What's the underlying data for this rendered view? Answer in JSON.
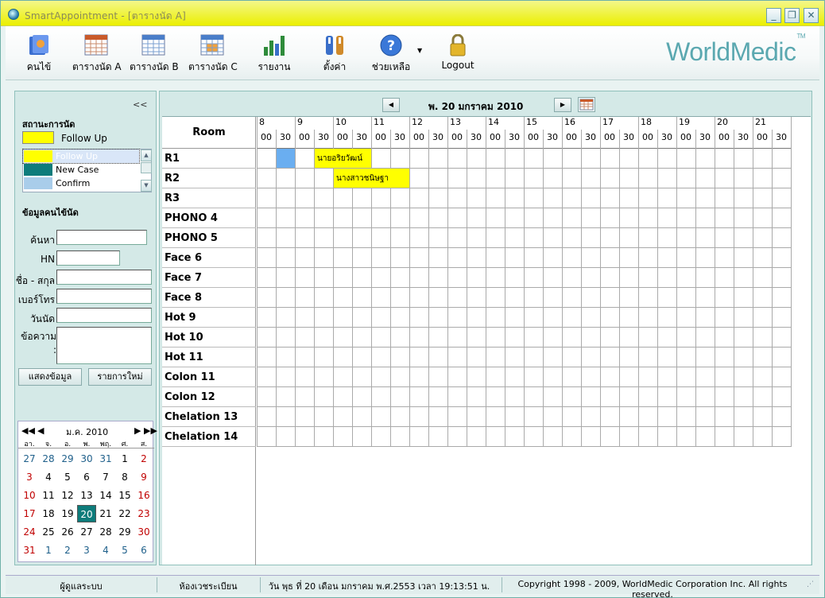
{
  "window": {
    "title": "SmartAppointment - [ตารางนัด A]"
  },
  "toolbar": {
    "items": [
      {
        "label": "คนไข้",
        "icon": "patient-book-icon"
      },
      {
        "label": "ตารางนัด A",
        "icon": "calendar-a-icon"
      },
      {
        "label": "ตารางนัด B",
        "icon": "calendar-b-icon"
      },
      {
        "label": "ตารางนัด C",
        "icon": "calendar-c-icon"
      },
      {
        "label": "รายงาน",
        "icon": "bar-chart-icon"
      },
      {
        "label": "ตั้งค่า",
        "icon": "tools-icon"
      },
      {
        "label": "ช่วยเหลือ",
        "icon": "help-icon"
      },
      {
        "label": "Logout",
        "icon": "padlock-icon"
      }
    ],
    "brand": "WorldMedic",
    "brand_tm": "TM"
  },
  "left": {
    "collapse": "<<",
    "status_title": "สถานะการนัด",
    "legend_selected": {
      "label": "Follow Up",
      "color": "#ffff00"
    },
    "status_list": [
      {
        "label": "Follow Up",
        "color": "#ffff00"
      },
      {
        "label": "New Case",
        "color": "#0e7c7b"
      },
      {
        "label": "Confirm",
        "color": "#a9cdea"
      }
    ],
    "patient_title": "ข้อมูลคนไข้นัด",
    "fields": {
      "search": "ค้นหา",
      "hn": "HN",
      "name": "ชื่อ - สกุล",
      "phone": "เบอร์โทร",
      "date": "วันนัด",
      "message": "ข้อความ :"
    },
    "btn_show": "แสดงข้อมูล",
    "btn_new": "รายการใหม่",
    "calendar": {
      "title": "ม.ค. 2010",
      "dow": [
        "อา.",
        "จ.",
        "อ.",
        "พ.",
        "พฤ.",
        "ศ.",
        "ส."
      ],
      "weeks": [
        [
          "27",
          "28",
          "29",
          "30",
          "31",
          "1",
          "2"
        ],
        [
          "3",
          "4",
          "5",
          "6",
          "7",
          "8",
          "9"
        ],
        [
          "10",
          "11",
          "12",
          "13",
          "14",
          "15",
          "16"
        ],
        [
          "17",
          "18",
          "19",
          "20",
          "21",
          "22",
          "23"
        ],
        [
          "24",
          "25",
          "26",
          "27",
          "28",
          "29",
          "30"
        ],
        [
          "31",
          "1",
          "2",
          "3",
          "4",
          "5",
          "6"
        ]
      ],
      "selected": "20"
    }
  },
  "schedule": {
    "date": "พ. 20 มกราคม 2010",
    "room_header": "Room",
    "hours": [
      "8",
      "9",
      "10",
      "11",
      "12",
      "13",
      "14",
      "15",
      "16",
      "17",
      "18",
      "19",
      "20",
      "21"
    ],
    "minute_labels": [
      "00",
      "30"
    ],
    "rooms": [
      "R1",
      "R2",
      "R3",
      "PHONO 4",
      "PHONO 5",
      "Face 6",
      "Face 7",
      "Face 8",
      "Hot 9",
      "Hot 10",
      "Hot 11",
      "Colon 11",
      "Colon 12",
      "Chelation 13",
      "Chelation 14"
    ],
    "appointments": [
      {
        "room": 0,
        "slot": 1,
        "span": 1,
        "label": "",
        "color": "#6aaef0"
      },
      {
        "room": 0,
        "slot": 3,
        "span": 3,
        "label": "นายอริยวัฒน์",
        "color": "#ffff00"
      },
      {
        "room": 1,
        "slot": 4,
        "span": 4,
        "label": "นางสาวชนิษฐา",
        "color": "#ffff00"
      }
    ]
  },
  "statusbar": {
    "user": "ผู้ดูแลระบบ",
    "room": "ห้องเวชระเบียน",
    "datetime": "วัน พุธ ที่ 20 เดือน มกราคม พ.ศ.2553 เวลา 19:13:51 น.",
    "copyright": "Copyright 1998 - 2009, WorldMedic Corporation Inc. All rights reserved."
  }
}
